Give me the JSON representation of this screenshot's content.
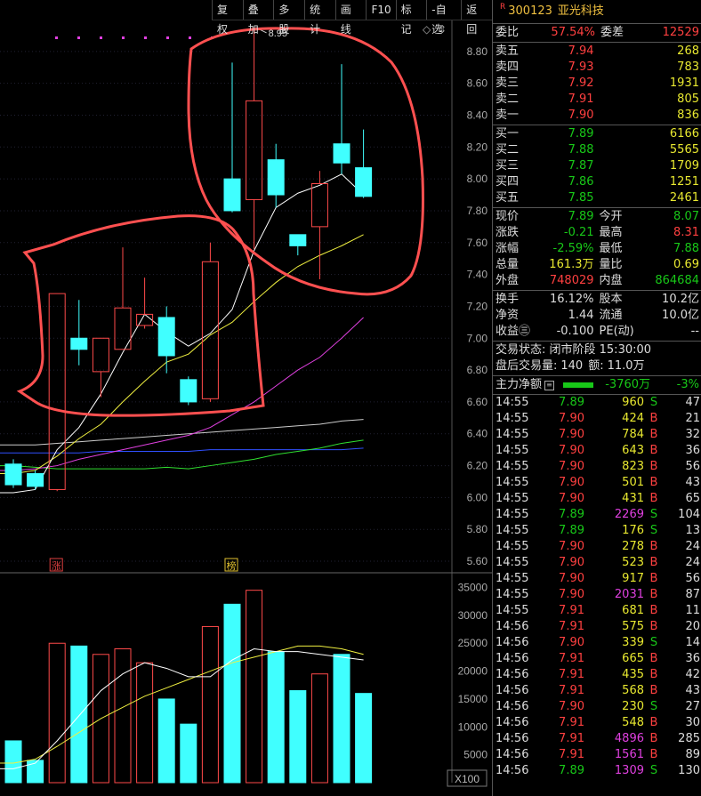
{
  "toolbar": {
    "items": [
      "复权",
      "叠加",
      "多股",
      "统计",
      "画线",
      "F10",
      "标记",
      "-自选",
      "返回"
    ]
  },
  "chart": {
    "high_marker": "8.95",
    "price_ticks": [
      "8.80",
      "8.60",
      "8.40",
      "8.20",
      "8.00",
      "7.80",
      "7.60",
      "7.40",
      "7.20",
      "7.00",
      "6.80",
      "6.60",
      "6.40",
      "6.20",
      "6.00",
      "5.80",
      "5.60"
    ],
    "volume_ticks": [
      "35000",
      "30000",
      "25000",
      "20000",
      "15000",
      "10000",
      "5000"
    ],
    "volume_unit": "X100",
    "markers": [
      {
        "text": "涨",
        "color": "#e04040"
      },
      {
        "text": "榜",
        "color": "#e0c030"
      }
    ],
    "colors": {
      "up": "#ff4a4a",
      "down": "#40ffff",
      "ma5": "#ffffff",
      "ma10": "#f0f040",
      "ma20": "#e040e0",
      "ma60": "#30e030",
      "ma120": "#3050ff",
      "ma250": "#cccccc",
      "annotation": "#ff5050"
    }
  },
  "chart_data": {
    "type": "candlestick",
    "price_range": [
      5.55,
      9.0
    ],
    "candles": [
      {
        "o": 6.21,
        "c": 6.08,
        "h": 6.24,
        "l": 6.06
      },
      {
        "o": 6.15,
        "c": 6.07,
        "h": 6.17,
        "l": 6.05
      },
      {
        "o": 6.05,
        "c": 7.28,
        "h": 7.28,
        "l": 6.04
      },
      {
        "o": 7.0,
        "c": 6.93,
        "h": 7.24,
        "l": 6.83
      },
      {
        "o": 6.79,
        "c": 7.0,
        "h": 7.0,
        "l": 6.63
      },
      {
        "o": 6.93,
        "c": 7.19,
        "h": 7.57,
        "l": 6.93
      },
      {
        "o": 7.08,
        "c": 7.15,
        "h": 7.38,
        "l": 7.06
      },
      {
        "o": 7.13,
        "c": 6.89,
        "h": 7.2,
        "l": 6.78
      },
      {
        "o": 6.74,
        "c": 6.6,
        "h": 6.76,
        "l": 6.58
      },
      {
        "o": 6.62,
        "c": 7.48,
        "h": 7.6,
        "l": 6.6
      },
      {
        "o": 8.0,
        "c": 7.8,
        "h": 8.73,
        "l": 7.79
      },
      {
        "o": 7.87,
        "c": 8.49,
        "h": 8.95,
        "l": 7.56
      },
      {
        "o": 8.12,
        "c": 7.9,
        "h": 8.22,
        "l": 7.82
      },
      {
        "o": 7.65,
        "c": 7.58,
        "h": 7.65,
        "l": 7.52
      },
      {
        "o": 7.7,
        "c": 7.97,
        "h": 8.05,
        "l": 7.37
      },
      {
        "o": 8.22,
        "c": 8.1,
        "h": 8.72,
        "l": 8.03
      },
      {
        "o": 8.07,
        "c": 7.89,
        "h": 8.31,
        "l": 7.88
      }
    ],
    "ma5": [
      6.03,
      6.05,
      6.3,
      6.44,
      6.65,
      6.91,
      7.15,
      7.04,
      6.95,
      7.03,
      7.18,
      7.55,
      7.82,
      7.91,
      7.96,
      8.03,
      7.9
    ],
    "ma10": [
      6.15,
      6.17,
      6.26,
      6.37,
      6.46,
      6.6,
      6.73,
      6.85,
      6.9,
      7.02,
      7.1,
      7.23,
      7.35,
      7.45,
      7.52,
      7.58,
      7.65
    ],
    "ma20": [
      6.17,
      6.18,
      6.2,
      6.24,
      6.27,
      6.3,
      6.33,
      6.36,
      6.39,
      6.44,
      6.52,
      6.6,
      6.7,
      6.8,
      6.88,
      7.0,
      7.13
    ],
    "ma60": [
      6.2,
      6.19,
      6.18,
      6.18,
      6.18,
      6.18,
      6.18,
      6.19,
      6.18,
      6.2,
      6.22,
      6.24,
      6.27,
      6.29,
      6.31,
      6.34,
      6.36
    ],
    "ma120": [
      6.28,
      6.28,
      6.28,
      6.28,
      6.29,
      6.29,
      6.29,
      6.29,
      6.29,
      6.3,
      6.3,
      6.3,
      6.3,
      6.3,
      6.3,
      6.3,
      6.31
    ],
    "ma250": [
      6.33,
      6.33,
      6.34,
      6.35,
      6.36,
      6.37,
      6.38,
      6.39,
      6.4,
      6.41,
      6.42,
      6.43,
      6.44,
      6.45,
      6.46,
      6.48,
      6.49
    ],
    "volume": [
      7500,
      4000,
      25000,
      24500,
      23000,
      24000,
      21500,
      15000,
      10500,
      28000,
      32000,
      34500,
      23500,
      16500,
      19500,
      23000,
      16000
    ],
    "vol_ma5": [
      2500,
      3500,
      7500,
      12000,
      16500,
      19500,
      21500,
      20500,
      19000,
      19000,
      22000,
      24000,
      23500,
      23500,
      23000,
      22500,
      22000
    ],
    "vol_ma10": [
      3500,
      4200,
      6500,
      9000,
      11500,
      13500,
      15500,
      17000,
      18500,
      20000,
      21500,
      22500,
      23500,
      24500,
      24500,
      24000,
      23000
    ]
  },
  "quote": {
    "code": "300123",
    "name": "亚光科技",
    "badge": "R",
    "weibi_label": "委比",
    "weibi": "57.54%",
    "weicha_label": "委差",
    "weicha": "12529",
    "asks": [
      {
        "l": "卖五",
        "p": "7.94",
        "v": "268"
      },
      {
        "l": "卖四",
        "p": "7.93",
        "v": "783"
      },
      {
        "l": "卖三",
        "p": "7.92",
        "v": "1931"
      },
      {
        "l": "卖二",
        "p": "7.91",
        "v": "805"
      },
      {
        "l": "卖一",
        "p": "7.90",
        "v": "836"
      }
    ],
    "bids": [
      {
        "l": "买一",
        "p": "7.89",
        "v": "6166"
      },
      {
        "l": "买二",
        "p": "7.88",
        "v": "5565"
      },
      {
        "l": "买三",
        "p": "7.87",
        "v": "1709"
      },
      {
        "l": "买四",
        "p": "7.86",
        "v": "1251"
      },
      {
        "l": "买五",
        "p": "7.85",
        "v": "2461"
      }
    ],
    "stats1": [
      {
        "a": "现价",
        "b": "7.89",
        "bc": "g",
        "c": "今开",
        "d": "8.07",
        "dc": "g"
      },
      {
        "a": "涨跌",
        "b": "-0.21",
        "bc": "g",
        "c": "最高",
        "d": "8.31",
        "dc": "rd"
      },
      {
        "a": "涨幅",
        "b": "-2.59%",
        "bc": "g",
        "c": "最低",
        "d": "7.88",
        "dc": "g"
      },
      {
        "a": "总量",
        "b": "161.3万",
        "bc": "y",
        "c": "量比",
        "d": "0.69",
        "dc": "y"
      },
      {
        "a": "外盘",
        "b": "748029",
        "bc": "rd",
        "c": "内盘",
        "d": "864684",
        "dc": "g"
      }
    ],
    "stats2": [
      {
        "a": "换手",
        "b": "16.12%",
        "c": "股本",
        "d": "10.2亿"
      },
      {
        "a": "净资",
        "b": "1.44",
        "c": "流通",
        "d": "10.0亿"
      },
      {
        "a": "收益㊂",
        "b": "-0.100",
        "c": "PE(动)",
        "d": "--"
      }
    ],
    "status": "交易状态: 闭市阶段 15:30:00",
    "after_hours_label": "盘后交易量:",
    "after_hours_vol": "140",
    "after_hours_amt_label": "额:",
    "after_hours_amt": "11.0万",
    "flow_label": "主力净额",
    "flow_value": "-3760万",
    "flow_pct": "-3%"
  },
  "ticks": [
    {
      "t": "14:55",
      "p": "7.89",
      "v": "960",
      "f": "S",
      "n": "47"
    },
    {
      "t": "14:55",
      "p": "7.90",
      "v": "424",
      "f": "B",
      "n": "21"
    },
    {
      "t": "14:55",
      "p": "7.90",
      "v": "784",
      "f": "B",
      "n": "32"
    },
    {
      "t": "14:55",
      "p": "7.90",
      "v": "643",
      "f": "B",
      "n": "36"
    },
    {
      "t": "14:55",
      "p": "7.90",
      "v": "823",
      "f": "B",
      "n": "56"
    },
    {
      "t": "14:55",
      "p": "7.90",
      "v": "501",
      "f": "B",
      "n": "43"
    },
    {
      "t": "14:55",
      "p": "7.90",
      "v": "431",
      "f": "B",
      "n": "65"
    },
    {
      "t": "14:55",
      "p": "7.89",
      "v": "2269",
      "f": "S",
      "n": "104"
    },
    {
      "t": "14:55",
      "p": "7.89",
      "v": "176",
      "f": "S",
      "n": "13"
    },
    {
      "t": "14:55",
      "p": "7.90",
      "v": "278",
      "f": "B",
      "n": "24"
    },
    {
      "t": "14:55",
      "p": "7.90",
      "v": "523",
      "f": "B",
      "n": "24"
    },
    {
      "t": "14:55",
      "p": "7.90",
      "v": "917",
      "f": "B",
      "n": "56"
    },
    {
      "t": "14:55",
      "p": "7.90",
      "v": "2031",
      "f": "B",
      "n": "87"
    },
    {
      "t": "14:55",
      "p": "7.91",
      "v": "681",
      "f": "B",
      "n": "11"
    },
    {
      "t": "14:56",
      "p": "7.91",
      "v": "575",
      "f": "B",
      "n": "20"
    },
    {
      "t": "14:56",
      "p": "7.90",
      "v": "339",
      "f": "S",
      "n": "14"
    },
    {
      "t": "14:56",
      "p": "7.91",
      "v": "665",
      "f": "B",
      "n": "36"
    },
    {
      "t": "14:56",
      "p": "7.91",
      "v": "435",
      "f": "B",
      "n": "42"
    },
    {
      "t": "14:56",
      "p": "7.91",
      "v": "568",
      "f": "B",
      "n": "43"
    },
    {
      "t": "14:56",
      "p": "7.90",
      "v": "230",
      "f": "S",
      "n": "27"
    },
    {
      "t": "14:56",
      "p": "7.91",
      "v": "548",
      "f": "B",
      "n": "30"
    },
    {
      "t": "14:56",
      "p": "7.91",
      "v": "4896",
      "f": "B",
      "n": "285"
    },
    {
      "t": "14:56",
      "p": "7.91",
      "v": "1561",
      "f": "B",
      "n": "89"
    },
    {
      "t": "14:56",
      "p": "7.89",
      "v": "1309",
      "f": "S",
      "n": "130"
    }
  ]
}
